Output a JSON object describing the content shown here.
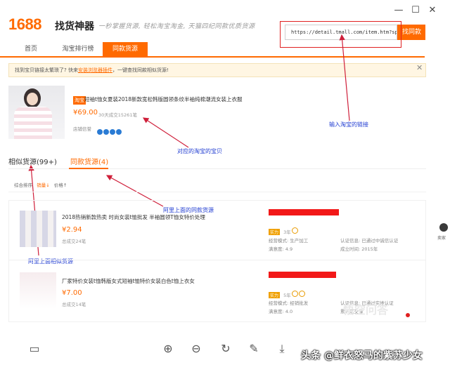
{
  "window": {
    "min": "—",
    "max": "☐",
    "close": "✕"
  },
  "header": {
    "logo": "1688",
    "app_name": "找货神器",
    "slogan": "一秒掌握货源, 轻松淘宝淘金, 天猫四纪同款优质货源",
    "url_value": "https://detail.tmall.com/item.htm?spm=a230r.1.14",
    "search_label": "找同款"
  },
  "tabs": [
    {
      "label": "首页"
    },
    {
      "label": "淘宝排行榜"
    },
    {
      "label": "同款货源"
    }
  ],
  "notice": {
    "text": "找到宝贝链接太繁琐了? 快来",
    "link": "安装浏览器插件",
    "rest": "，一键查找同款相似货源!",
    "close": "✕"
  },
  "product": {
    "tag": "淘宝",
    "title": "短袖t恤女夏装2018新款宽松韩版圆领条纹半袖纯棉潮流女装上衣服",
    "price": "¥69.00",
    "sold": "30天成交15261笔",
    "shop_label": "店铺信誉",
    "crown_count": 4
  },
  "annotations": {
    "url": "输入淘宝的链接",
    "product": "对应的淘宝的宝贝",
    "same": "阿里上面的同款货源",
    "similar": "阿里上面相似货源"
  },
  "section_tabs": {
    "similar": "相似货源(99+)",
    "same": "同款货源(4)"
  },
  "sort_bar": {
    "all": "综合排序",
    "sales": "销量↓",
    "price": "价格↑"
  },
  "items": [
    {
      "title": "2018热销新款热卖 时尚女装t恤批发 半袖圆领T恤女特价处理",
      "price": "¥2.94",
      "sold": "总成交24笔",
      "supplier_badge": "实力",
      "supplier_years": "3年",
      "model_label": "经营模式: 生产加工",
      "auth_label": "认证信息: 已通过中诚信认证",
      "rating_label": "满意度: 4.9",
      "est_label": "成立时间: 2015年"
    },
    {
      "title": "厂家特价女装t恤韩版女式短袖t恤特价女装白色t恤上衣女",
      "price": "¥7.00",
      "sold": "总成交14笔",
      "supplier_badge": "实力",
      "supplier_years": "5年",
      "model_label": "经营模式: 经销批发",
      "auth_label": "认证信息: 已通过实地认证",
      "rating_label": "满意度: 4.0",
      "est_label": "累计成交量"
    }
  ],
  "toolbar": {
    "layout": "▭",
    "zoom_in": "⊕",
    "zoom_out": "⊖",
    "rotate": "↻",
    "edit": "✎",
    "download": "⤓"
  },
  "watermark": {
    "text": "头条 @鲜衣怒马的紫苏少女",
    "faint": "悟空问答"
  },
  "side": {
    "label": "卖家"
  }
}
